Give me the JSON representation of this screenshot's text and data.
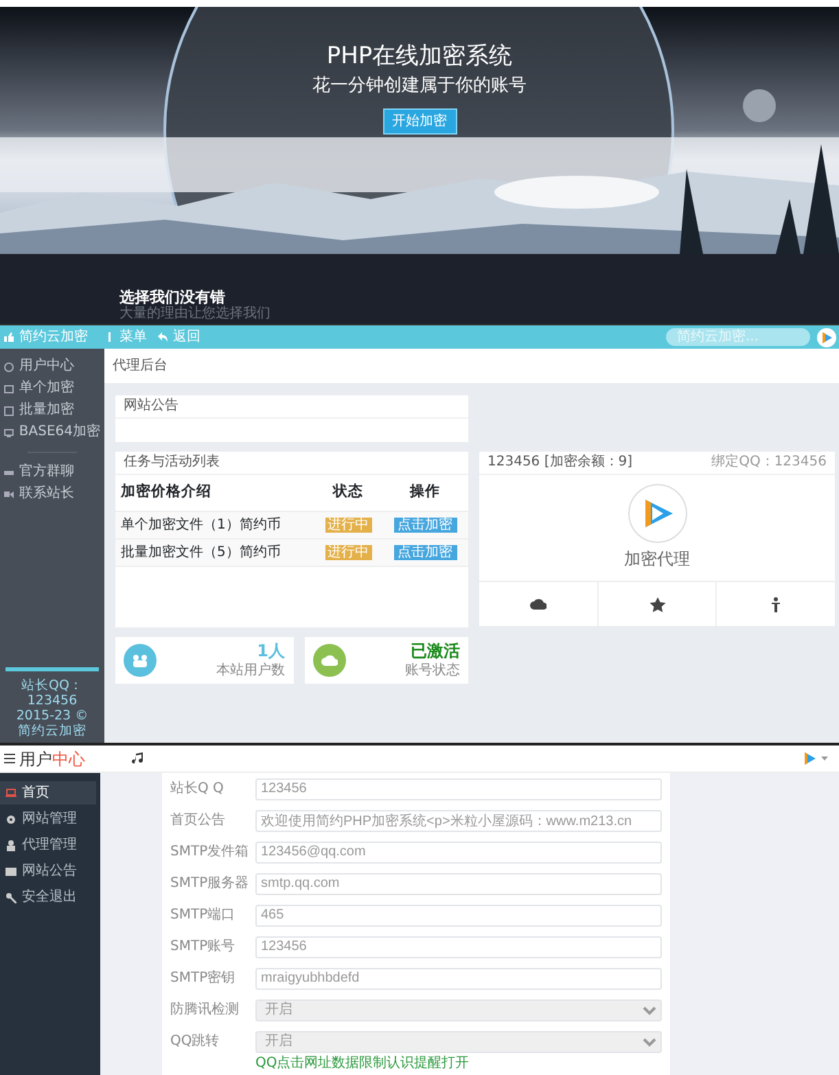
{
  "hero": {
    "title": "PHP在线加密系统",
    "subtitle": "花一分钟创建属于你的账号",
    "button": "开始加密"
  },
  "intro": {
    "heading": "选择我们没有错",
    "text": "大量的理由让您选择我们"
  },
  "admin": {
    "brand": "简约云加密",
    "toolbar": [
      "菜单",
      "返回"
    ],
    "search": {
      "placeholder": "简约云加密..."
    },
    "sidebar_groups": [
      [
        {
          "label": "用户中心"
        },
        {
          "label": "单个加密"
        },
        {
          "label": "批量加密"
        },
        {
          "label": "BASE64加密"
        }
      ],
      [
        {
          "label": "官方群聊"
        },
        {
          "label": "联系站长"
        }
      ]
    ],
    "footer": [
      "站长QQ：123456",
      "2015-23 © ",
      "简约云加密"
    ],
    "page_title": "代理后台",
    "notice": {
      "title": "网站公告"
    },
    "tasks": {
      "title": "任务与活动列表",
      "columns": [
        "加密价格介绍",
        "状态",
        "操作"
      ],
      "rows": [
        {
          "item": "单个加密文件（1）简约币",
          "status": "进行中",
          "action": "点击加密"
        },
        {
          "item": "批量加密文件（5）简约币",
          "status": "进行中",
          "action": "点击加密"
        }
      ]
    },
    "profile": {
      "account": "123456 [加密余额：9]",
      "qq": "绑定QQ：123456",
      "role": "加密代理"
    },
    "stats": [
      {
        "value": "1人",
        "label": "本站用户数",
        "color": "#5bc0de"
      },
      {
        "value": "已激活",
        "label": "账号状态",
        "color": "#8cc152"
      }
    ]
  },
  "user_center": {
    "brand": "用户",
    "brand_accent": "中心",
    "sidebar": [
      {
        "label": "首页",
        "selected": true
      },
      {
        "label": "网站管理",
        "selected": false
      },
      {
        "label": "代理管理",
        "selected": false
      },
      {
        "label": "网站公告",
        "selected": false
      },
      {
        "label": "安全退出",
        "selected": false
      }
    ],
    "fields": [
      {
        "label": "站长Q Q",
        "kind": "input",
        "value": "123456"
      },
      {
        "label": "首页公告",
        "kind": "input",
        "value": "欢迎使用简约PHP加密系统<p>米粒小屋源码：www.m213.cn"
      },
      {
        "label": "SMTP发件箱",
        "kind": "input",
        "value": "123456@qq.com"
      },
      {
        "label": "SMTP服务器",
        "kind": "input",
        "value": "smtp.qq.com"
      },
      {
        "label": "SMTP端口",
        "kind": "input",
        "value": "465"
      },
      {
        "label": "SMTP账号",
        "kind": "input",
        "value": "123456"
      },
      {
        "label": "SMTP密钥",
        "kind": "input",
        "value": "mraigyubhbdefd"
      },
      {
        "label": "防腾讯检测",
        "kind": "select",
        "value": "开启"
      },
      {
        "label": "QQ跳转",
        "kind": "select",
        "value": "开启",
        "help": "QQ点击网址数据限制认识提醒打开"
      }
    ]
  }
}
